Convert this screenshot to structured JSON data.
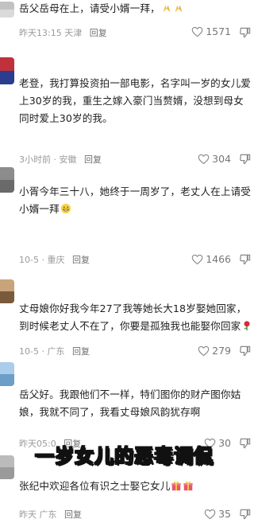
{
  "comments": [
    {
      "text": "岳父岳母在上，请受小婿一拜，",
      "time": "昨天13:15",
      "location": "天津",
      "reply_label": "回复",
      "likes": "1571",
      "avatar_colors": [
        "#b7b7b7",
        "#d9d9d9"
      ]
    },
    {
      "text": "老登，我打算投资拍一部电影，名字叫一岁的女儿爱上30岁的我，重生之嫁入豪门当赘婿，没想到母女同时爱上30岁的我。",
      "time": "3小时前",
      "location": "安徽",
      "reply_label": "回复",
      "likes": "304",
      "avatar_colors": [
        "#c1313c",
        "#2b3d8f"
      ]
    },
    {
      "text": "小胥今年三十八，她终于一周岁了，老丈人在上请受小婿一拜",
      "time": "10-5",
      "location": "重庆",
      "reply_label": "回复",
      "likes": "1466",
      "avatar_colors": [
        "#8c8c8c",
        "#5f5f5f"
      ]
    },
    {
      "text": "丈母娘你好我今年27了我等她长大18岁娶她回家，到时候老丈人不在了，你要是孤独我也能娶你回家",
      "time": "10-5",
      "location": "广东",
      "reply_label": "回复",
      "likes": "279",
      "avatar_colors": [
        "#c9a47a",
        "#7a5a3c"
      ]
    },
    {
      "text": "岳父好。我跟他们不一样，特们图你的财产图你姑娘，我就不同了，我看丈母娘风韵犹存啊",
      "time": "昨天05:0",
      "location": "",
      "reply_label": "回复",
      "likes": "30",
      "avatar_colors": [
        "#9fc5e8",
        "#6d9ec7"
      ]
    },
    {
      "text": "张纪中欢迎各位有识之士娶它女儿",
      "time": "昨天",
      "location": "广东",
      "reply_label": "回复",
      "likes": "35",
      "avatar_colors": [
        "#bbbbbb",
        "#999999"
      ]
    }
  ],
  "overlay_caption": "一岁女儿的恶毒调侃",
  "icons": {
    "like": "heart-outline-icon",
    "dislike": "thumbs-down-icon",
    "emoji_pray": "praying-hands-emoji-icon",
    "emoji_grin": "grinning-face-emoji-icon",
    "emoji_rose": "rose-emoji-icon",
    "emoji_gift": "gift-emoji-icon"
  }
}
